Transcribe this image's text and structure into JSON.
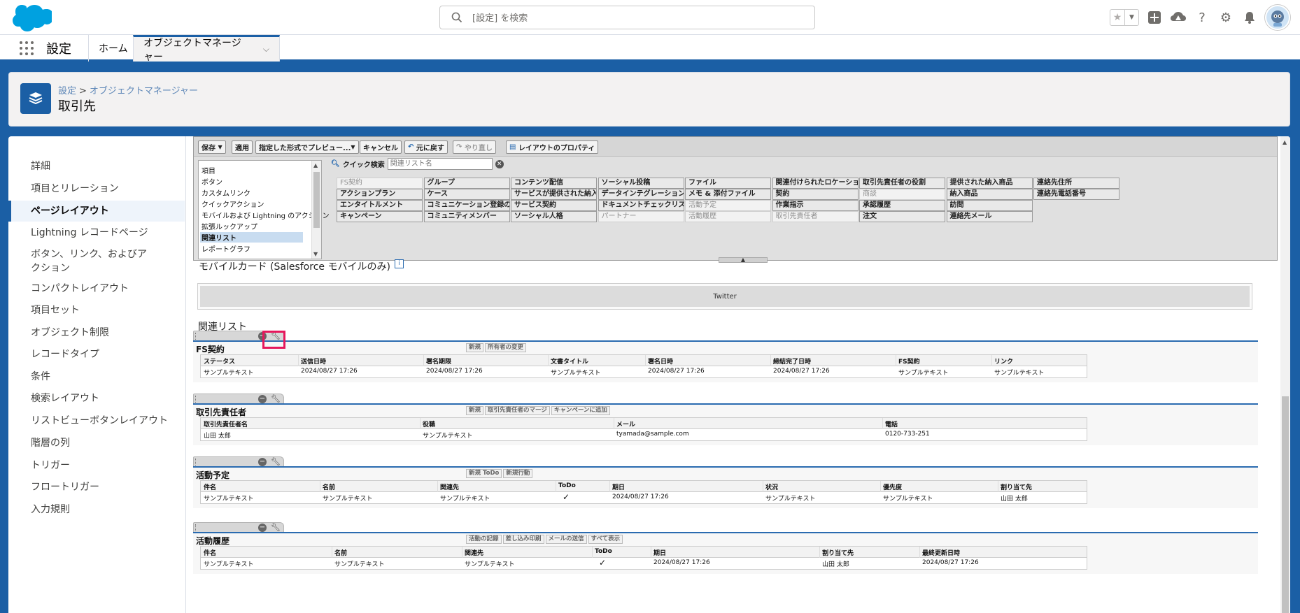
{
  "header": {
    "search_placeholder": "[設定] を検索",
    "icons": [
      "favorites-star-icon",
      "favorites-dropdown-icon",
      "add-icon",
      "trailhead-icon",
      "help-icon",
      "setup-gear-icon",
      "notifications-bell-icon",
      "user-avatar"
    ]
  },
  "nav": {
    "app_name": "設定",
    "home": "ホーム",
    "object_manager": "オブジェクトマネージャー"
  },
  "page": {
    "breadcrumb_setup": "設定",
    "breadcrumb_sep": ">",
    "breadcrumb_objmgr": "オブジェクトマネージャー",
    "title": "取引先"
  },
  "sidebar": {
    "items": [
      {
        "label": "詳細"
      },
      {
        "label": "項目とリレーション"
      },
      {
        "label": "ページレイアウト"
      },
      {
        "label": "Lightning レコードページ"
      },
      {
        "label": "ボタン、リンク、およびアクション"
      },
      {
        "label": "コンパクトレイアウト"
      },
      {
        "label": "項目セット"
      },
      {
        "label": "オブジェクト制限"
      },
      {
        "label": "レコードタイプ"
      },
      {
        "label": "条件"
      },
      {
        "label": "検索レイアウト"
      },
      {
        "label": "リストビューボタンレイアウト"
      },
      {
        "label": "階層の列"
      },
      {
        "label": "トリガー"
      },
      {
        "label": "フロートリガー"
      },
      {
        "label": "入力規則"
      }
    ],
    "active": "ページレイアウト"
  },
  "toolbar": {
    "save": "保存",
    "apply": "適用",
    "preview": "指定した形式でプレビュー...",
    "cancel": "キャンセル",
    "undo": "元に戻す",
    "redo": "やり直し",
    "layout_props": "レイアウトのプロパティ"
  },
  "palette": {
    "categories": [
      "項目",
      "ボタン",
      "カスタムリンク",
      "クイックアクション",
      "モバイルおよび Lightning のアクション",
      "拡張ルックアップ",
      "関連リスト",
      "レポートグラフ"
    ],
    "selected_category": "関連リスト",
    "quick_search_label": "クイック検索",
    "quick_search_placeholder": "関連リスト名",
    "columns": [
      [
        "FS契約",
        "アクションプラン",
        "エンタイトルメント",
        "キャンペーン"
      ],
      [
        "グループ",
        "ケース",
        "コミュニケーション登録の同意",
        "コミュニティメンバー"
      ],
      [
        "コンテンツ配信",
        "サービスが提供された納入商品",
        "サービス契約",
        "ソーシャル人格"
      ],
      [
        "ソーシャル投稿",
        "データインテグレーションルール",
        "ドキュメントチェックリスト項目",
        "パートナー"
      ],
      [
        "ファイル",
        "メモ & 添付ファイル",
        "活動予定",
        "活動履歴"
      ],
      [
        "関連付けられたロケーション",
        "契約",
        "作業指示",
        "取引先責任者"
      ],
      [
        "取引先責任者の役割",
        "商談",
        "承認履歴",
        "注文"
      ],
      [
        "提供された納入商品",
        "納入商品",
        "訪問",
        "連絡先メール"
      ],
      [
        "連絡先住所",
        "連絡先電話番号"
      ]
    ],
    "used_items": [
      "FS契約",
      "パートナー",
      "活動予定",
      "活動履歴",
      "取引先責任者",
      "商談"
    ]
  },
  "canvas": {
    "mobile_card_title": "モバイルカード (Salesforce モバイルのみ)",
    "twitter": "Twitter",
    "related_lists_label": "関連リスト",
    "lists": [
      {
        "title": "FS契約",
        "buttons": [
          "新規",
          "所有者の変更"
        ],
        "columns": [
          "ステータス",
          "送信日時",
          "署名期限",
          "文書タイトル",
          "署名日時",
          "締結完了日時",
          "FS契約",
          "リンク"
        ],
        "row": [
          "サンプルテキスト",
          "2024/08/27 17:26",
          "2024/08/27 17:26",
          "サンプルテキスト",
          "2024/08/27 17:26",
          "2024/08/27 17:26",
          "サンプルテキスト",
          "サンプルテキスト"
        ]
      },
      {
        "title": "取引先責任者",
        "buttons": [
          "新規",
          "取引先責任者のマージ",
          "キャンペーンに追加"
        ],
        "columns": [
          "取引先責任者名",
          "役職",
          "メール",
          "電話"
        ],
        "row": [
          "山田 太郎",
          "サンプルテキスト",
          "tyamada@sample.com",
          "0120-733-251"
        ]
      },
      {
        "title": "活動予定",
        "buttons": [
          "新規 ToDo",
          "新規行動"
        ],
        "columns": [
          "件名",
          "名前",
          "関連先",
          "ToDo",
          "期日",
          "状況",
          "優先度",
          "割り当て先"
        ],
        "row": [
          "サンプルテキスト",
          "サンプルテキスト",
          "サンプルテキスト",
          "✓",
          "2024/08/27 17:26",
          "サンプルテキスト",
          "サンプルテキスト",
          "山田 太郎"
        ]
      },
      {
        "title": "活動履歴",
        "buttons": [
          "活動の記録",
          "差し込み印刷",
          "メールの送信",
          "すべて表示"
        ],
        "columns": [
          "件名",
          "名前",
          "関連先",
          "ToDo",
          "期日",
          "割り当て先",
          "最終更新日時"
        ],
        "row": [
          "サンプルテキスト",
          "サンプルテキスト",
          "サンプルテキスト",
          "✓",
          "2024/08/27 17:26",
          "山田 太郎",
          "2024/08/27 17:26"
        ]
      }
    ]
  }
}
